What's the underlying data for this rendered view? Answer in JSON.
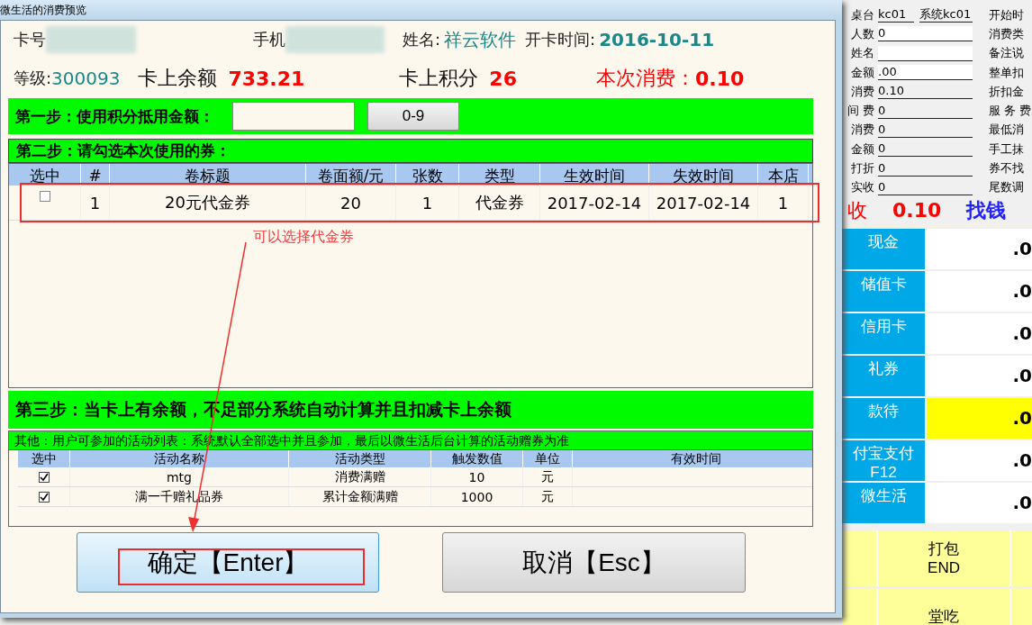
{
  "window": {
    "title": "微生活的消费预览"
  },
  "card": {
    "card_label": "卡号",
    "phone_label": "手机",
    "name_label": "姓名:",
    "name": "祥云软件",
    "open_label": "开卡时间:",
    "open_date": "2016-10-11",
    "level_label": "等级:",
    "level": "300093",
    "balance_label": "卡上余额",
    "balance": "733.21",
    "points_label": "卡上积分",
    "points": "26",
    "consume_label": "本次消费：",
    "consume": "0.10"
  },
  "step1": {
    "title": "第一步：使用积分抵用金额：",
    "button": "0-9"
  },
  "step2": {
    "title": "第二步：请勾选本次使用的券：",
    "check_column": "选中",
    "columns": [
      "#",
      "卷标题",
      "卷面额/元",
      "张数",
      "类型",
      "生效时间",
      "失效时间",
      "本店"
    ],
    "rows": [
      {
        "checked": false,
        "cells": [
          "1",
          "20元代金券",
          "20",
          "1",
          "代金券",
          "2017-02-14",
          "2017-02-14",
          "1"
        ]
      }
    ]
  },
  "step3": {
    "title": "第三步：当卡上有余额，不足部分系统自动计算并且扣减卡上余额"
  },
  "other": {
    "title": "其他：用户可参加的活动列表：系统默认全部选中并且参加，最后以微生活后台计算的活动赠券为准",
    "check_column": "选中",
    "columns": [
      "活动名称",
      "活动类型",
      "触发数值",
      "单位",
      "有效时间"
    ],
    "rows": [
      {
        "checked": true,
        "cells": [
          "mtg",
          "消费满赠",
          "10",
          "元",
          ""
        ]
      },
      {
        "checked": true,
        "cells": [
          "满一千赠礼品券",
          "累计金额满赠",
          "1000",
          "元",
          ""
        ]
      }
    ]
  },
  "buttons": [
    {
      "label": "确定【Enter】",
      "kind": "primary"
    },
    {
      "label": "取消【Esc】",
      "kind": "secondary"
    }
  ],
  "annotation": {
    "text": "可以选择代金券"
  },
  "pos": {
    "fields": [
      {
        "label": "桌台",
        "value": "kc01",
        "extra": "系统kc01"
      },
      {
        "label": "人数",
        "value": "0"
      },
      {
        "label": "姓名"
      },
      {
        "label": "金额",
        "value": ".00"
      },
      {
        "label": "消费",
        "value": "0.10"
      },
      {
        "label": "间 费",
        "value": "0"
      },
      {
        "label": "消费",
        "value": "0"
      },
      {
        "label": "金额",
        "value": "0"
      },
      {
        "label": "打折",
        "value": "0"
      },
      {
        "label": "实收",
        "value": "0"
      }
    ],
    "side_labels": [
      "开始时",
      "消费类",
      "备注说",
      "整单扣",
      "折扣金",
      "服 务 费",
      "最低消",
      "手工抹",
      "券不找",
      "尾数调"
    ],
    "due_label": "收",
    "due": "0.10",
    "change_label": "找钱",
    "payments": [
      {
        "label": "现金",
        "value": ".0",
        "highlighted": false
      },
      {
        "label": "储值卡",
        "value": ".0",
        "highlighted": false
      },
      {
        "label": "信用卡",
        "value": ".0",
        "highlighted": false
      },
      {
        "label": "礼券",
        "value": ".0",
        "highlighted": false
      },
      {
        "label": "款待",
        "value": ".0",
        "highlighted": true
      },
      {
        "label": "付宝支付\nF12",
        "value": ".0",
        "highlighted": false
      },
      {
        "label": "微生活",
        "value": ".0",
        "highlighted": false
      }
    ],
    "modes": [
      "打包\nEND",
      "堂吃"
    ]
  }
}
